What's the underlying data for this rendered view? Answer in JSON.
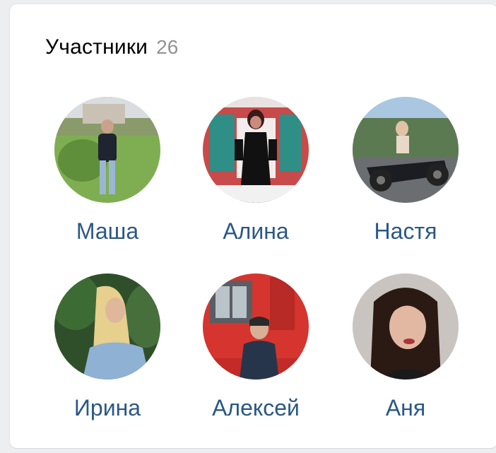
{
  "block": {
    "title": "Участники",
    "count": "26"
  },
  "members": [
    {
      "name": "Маша",
      "avatar": "person-outdoors-grass"
    },
    {
      "name": "Алина",
      "avatar": "person-black-dress"
    },
    {
      "name": "Настя",
      "avatar": "person-motorcycle"
    },
    {
      "name": "Ирина",
      "avatar": "person-blonde-hair"
    },
    {
      "name": "Алексей",
      "avatar": "person-red-tram"
    },
    {
      "name": "Аня",
      "avatar": "person-dark-hair-portrait"
    }
  ],
  "colors": {
    "link": "#2a5885",
    "count": "#939393",
    "background": "#edeef0",
    "card": "#ffffff"
  }
}
